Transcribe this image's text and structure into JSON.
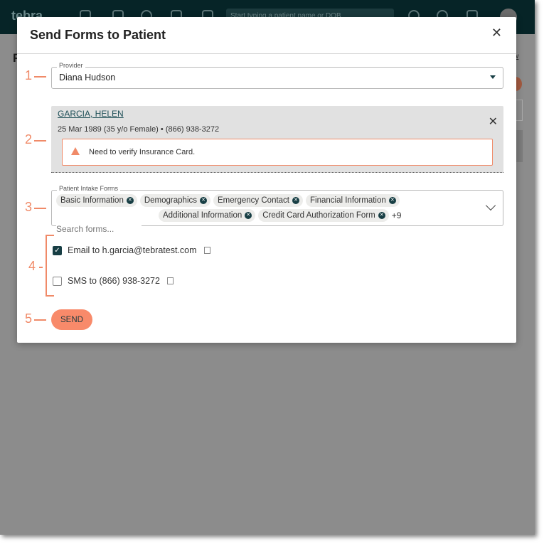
{
  "app": {
    "logo": "tebra",
    "search_placeholder": "Start typing a patient name or DOB",
    "bg_heading": "F",
    "bg_link": "w"
  },
  "modal": {
    "title": "Send Forms to Patient",
    "close_icon": "close-icon"
  },
  "steps": [
    "1",
    "2",
    "3",
    "4",
    "5"
  ],
  "provider": {
    "label": "Provider",
    "value": "Diana Hudson"
  },
  "patient": {
    "name": "GARCIA, HELEN",
    "dob": "25 Mar 1989 (35 y/o Female)",
    "separator": "•",
    "phone": "(866) 938-3272",
    "alert": "Need to verify Insurance Card."
  },
  "forms": {
    "label": "Patient Intake Forms",
    "selected": [
      "Basic Information",
      "Demographics",
      "Emergency Contact",
      "Financial Information",
      "Additional Information",
      "Credit Card Authorization Form"
    ],
    "more": "+9",
    "placeholder": "Search forms..."
  },
  "delivery": {
    "email": {
      "label": "Email to h.garcia@tebratest.com",
      "checked": true
    },
    "sms": {
      "label": "SMS to (866) 938-3272",
      "checked": false
    }
  },
  "send_label": "SEND",
  "colors": {
    "accent": "#f88a6a",
    "brand": "#173e44",
    "header": "#062427"
  }
}
